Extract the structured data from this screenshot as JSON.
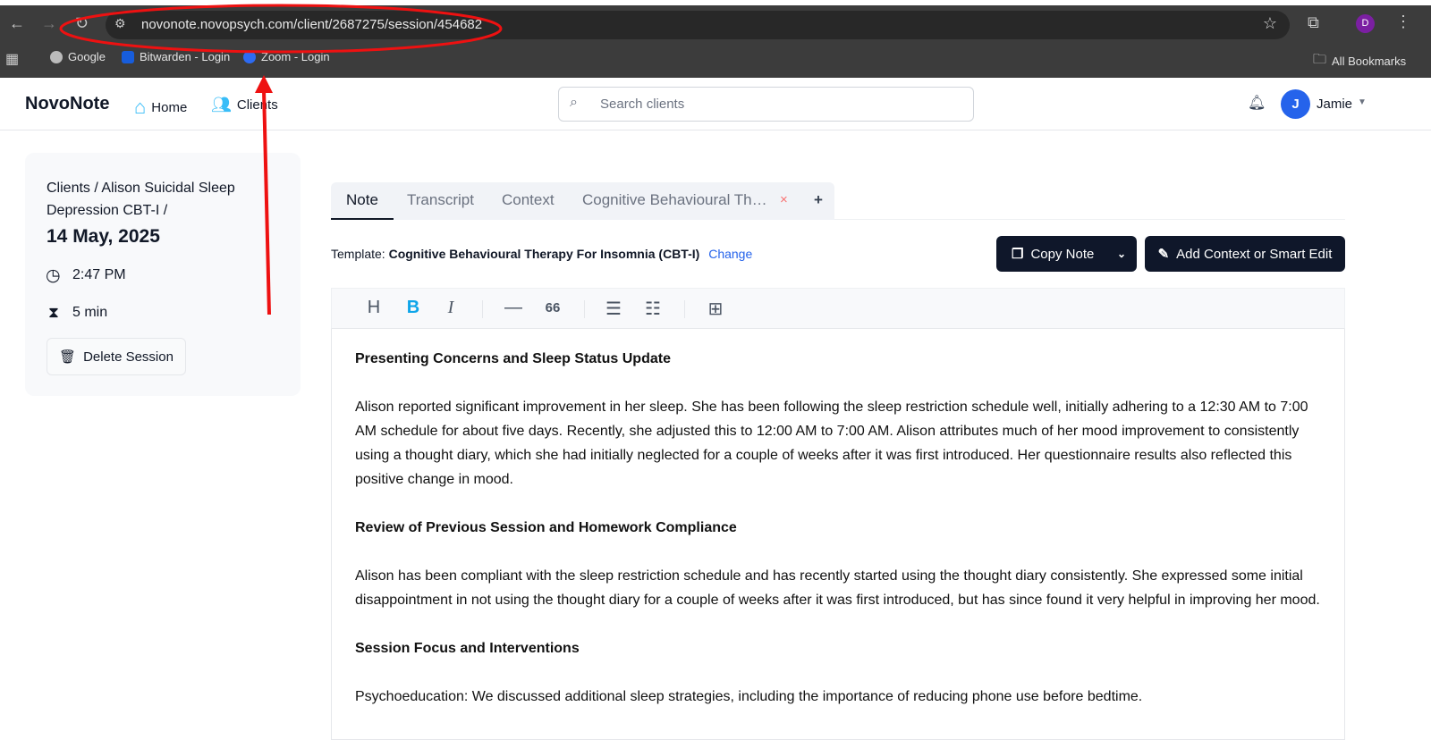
{
  "browser": {
    "url": "novonote.novopsych.com/client/2687275/session/454682",
    "bookmarks": [
      "Google",
      "Bitwarden - Login",
      "Zoom - Login"
    ],
    "all_bookmarks": "All Bookmarks",
    "profile_initial": "D"
  },
  "header": {
    "logo": "NovoNote",
    "nav": [
      "Home",
      "Clients"
    ],
    "search_placeholder": "Search clients",
    "user_initial": "J",
    "user_name": "Jamie"
  },
  "session": {
    "breadcrumb": "Clients / Alison Suicidal Sleep Depression CBT-I /",
    "date": "14 May, 2025",
    "time": "2:47 PM",
    "duration": "5 min",
    "delete_label": "Delete Session"
  },
  "tabs": [
    "Note",
    "Transcript",
    "Context",
    "Cognitive Behavioural Th…"
  ],
  "template": {
    "label": "Template:",
    "name": "Cognitive Behavioural Therapy For Insomnia (CBT-I)",
    "change": "Change"
  },
  "actions": {
    "copy": "Copy Note",
    "smart_edit": "Add Context or Smart Edit"
  },
  "note": [
    {
      "heading": "Presenting Concerns and Sleep Status Update",
      "text": "Alison reported significant improvement in her sleep. She has been following the sleep restriction schedule well, initially adhering to a 12:30 AM to 7:00 AM schedule for about five days. Recently, she adjusted this to 12:00 AM to 7:00 AM. Alison attributes much of her mood improvement to consistently using a thought diary, which she had initially neglected for a couple of weeks after it was first introduced. Her questionnaire results also reflected this positive change in mood."
    },
    {
      "heading": "Review of Previous Session and Homework Compliance",
      "text": "Alison has been compliant with the sleep restriction schedule and has recently started using the thought diary consistently. She expressed some initial disappointment in not using the thought diary for a couple of weeks after it was first introduced, but has since found it very helpful in improving her mood."
    },
    {
      "heading": "Session Focus and Interventions",
      "text": "Psychoeducation: We discussed additional sleep strategies, including the importance of reducing phone use before bedtime."
    }
  ]
}
